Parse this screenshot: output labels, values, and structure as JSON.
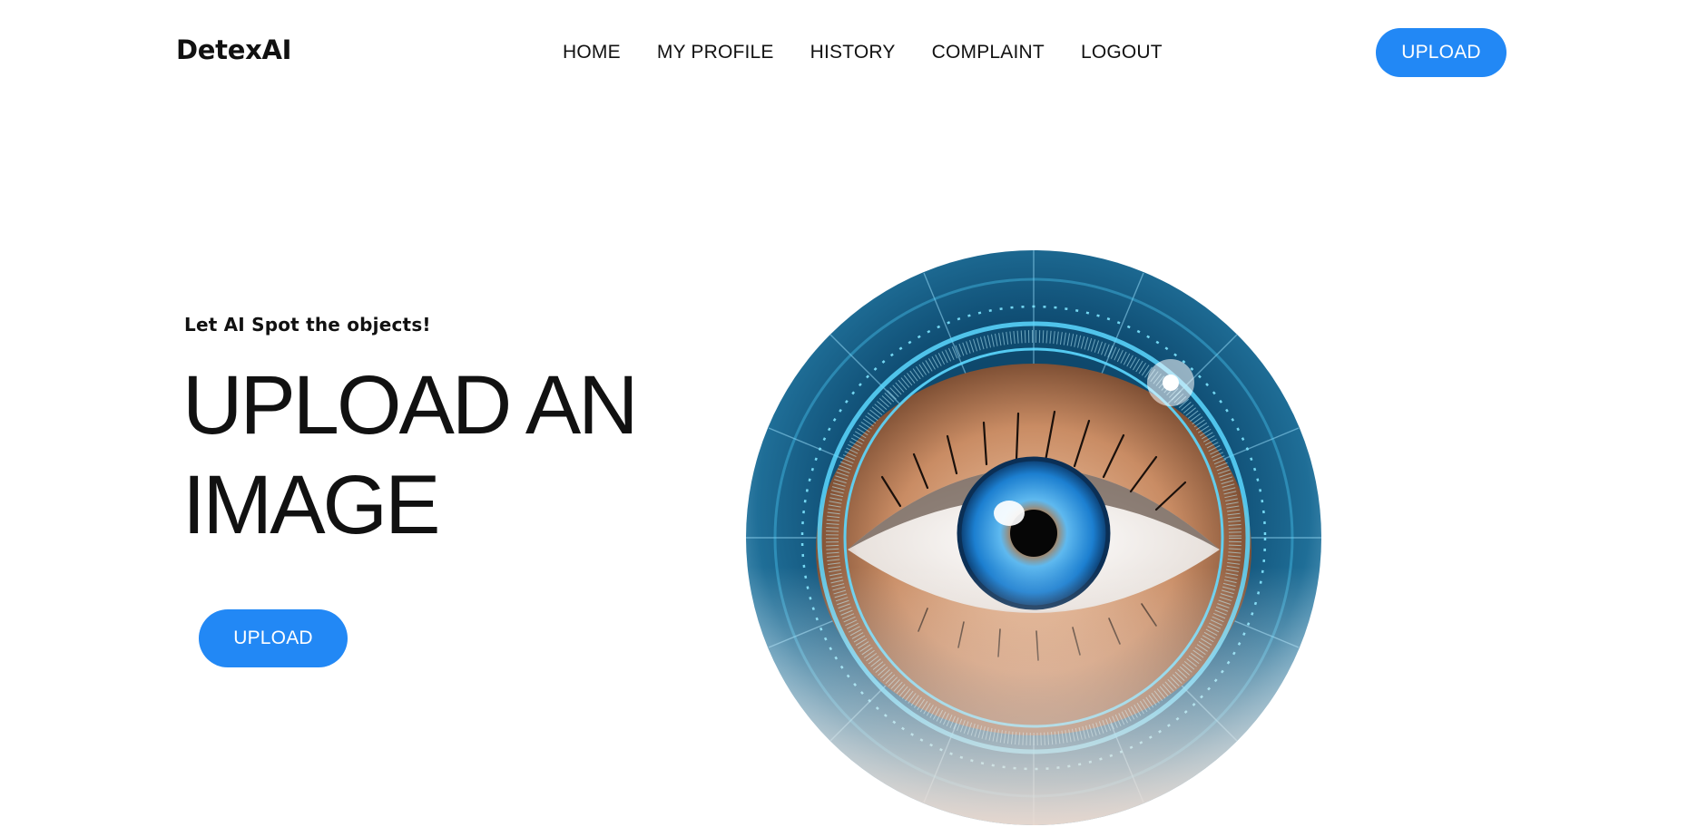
{
  "brand": {
    "name": "DetexAI"
  },
  "nav": {
    "items": [
      {
        "label": "HOME"
      },
      {
        "label": "MY PROFILE"
      },
      {
        "label": "HISTORY"
      },
      {
        "label": "COMPLAINT"
      },
      {
        "label": "LOGOUT"
      }
    ]
  },
  "header": {
    "upload_label": "UPLOAD"
  },
  "hero": {
    "tagline": "Let AI Spot the objects!",
    "title_line1": "UPLOAD AN",
    "title_line2": "IMAGE",
    "upload_label": "UPLOAD",
    "image_icon": "futuristic-eye-scan-icon"
  },
  "colors": {
    "accent": "#2288f5",
    "text": "#111111",
    "background": "#ffffff",
    "ring": "#4fd3ff"
  }
}
